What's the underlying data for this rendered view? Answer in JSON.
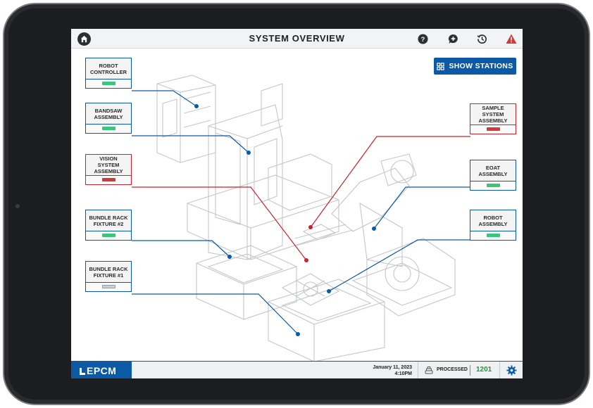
{
  "header": {
    "title": "SYSTEM OVERVIEW",
    "icons": [
      "home-icon",
      "help-icon",
      "chat-add-icon",
      "history-icon",
      "alert-icon"
    ]
  },
  "actions": {
    "show_stations_label": "SHOW STATIONS",
    "show_stations_icon": "grid-icon"
  },
  "stations": [
    {
      "label": "ROBOT CONTROLLER",
      "status": "ok"
    },
    {
      "label": "BANDSAW ASSEMBLY",
      "status": "ok"
    },
    {
      "label": "VISION SYSTEM ASSEMBLY",
      "status": "error"
    },
    {
      "label": "BUNDLE RACK FIXTURE #2",
      "status": "ok"
    },
    {
      "label": "BUNDLE RACK FIXTURE #1",
      "status": "idle"
    },
    {
      "label": "SAMPLE SYSTEM ASSEMBLY",
      "status": "error"
    },
    {
      "label": "EOAT ASSEMBLY",
      "status": "ok"
    },
    {
      "label": "ROBOT ASSEMBLY",
      "status": "ok"
    }
  ],
  "status_colors": {
    "ok": "#3cc47a",
    "error": "#d23a3a",
    "idle": "#c9d3e0",
    "accent": "#0c5aa6"
  },
  "footer": {
    "logo": "EPCM",
    "date": "January 11, 2023",
    "time": "4:10PM",
    "processed_label": "PROCESSED",
    "processed_count": "1201",
    "settings_icon": "gear-icon"
  }
}
